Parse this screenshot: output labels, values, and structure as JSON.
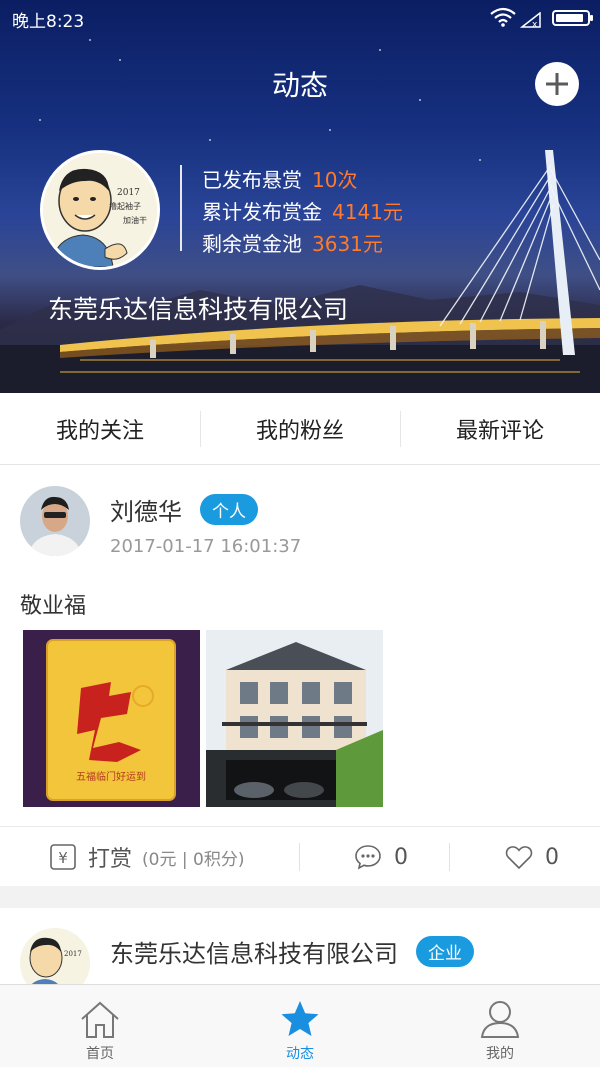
{
  "status_bar": {
    "time": "晚上8:23",
    "battery_level": 0.9
  },
  "header": {
    "title": "动态"
  },
  "profile": {
    "avatar_text": [
      "2017",
      "撸起袖子",
      "加油干"
    ],
    "stats": [
      {
        "label": "已发布悬赏",
        "value": "10次"
      },
      {
        "label": "累计发布赏金",
        "value": "4141元"
      },
      {
        "label": "剩余赏金池",
        "value": "3631元"
      }
    ],
    "company": "东莞乐达信息科技有限公司"
  },
  "tabs": [
    {
      "label": "我的关注"
    },
    {
      "label": "我的粉丝"
    },
    {
      "label": "最新评论"
    }
  ],
  "posts": [
    {
      "name": "刘德华",
      "badge": "个人",
      "time": "2017-01-17 16:01:37",
      "text": "敬业福",
      "image_text": "五福临门好运到",
      "actions": {
        "reward_label": "打赏",
        "reward_detail": "(0元 | 0积分)",
        "comments": "0",
        "likes": "0"
      }
    },
    {
      "name": "东莞乐达信息科技有限公司",
      "badge": "企业"
    }
  ],
  "bottom_nav": [
    {
      "label": "首页",
      "icon": "home-icon"
    },
    {
      "label": "动态",
      "icon": "star-icon"
    },
    {
      "label": "我的",
      "icon": "user-icon"
    }
  ],
  "colors": {
    "accent": "#1a9bdf",
    "stat_value": "#ff7a2b",
    "active_tab": "#1a8fe0"
  }
}
